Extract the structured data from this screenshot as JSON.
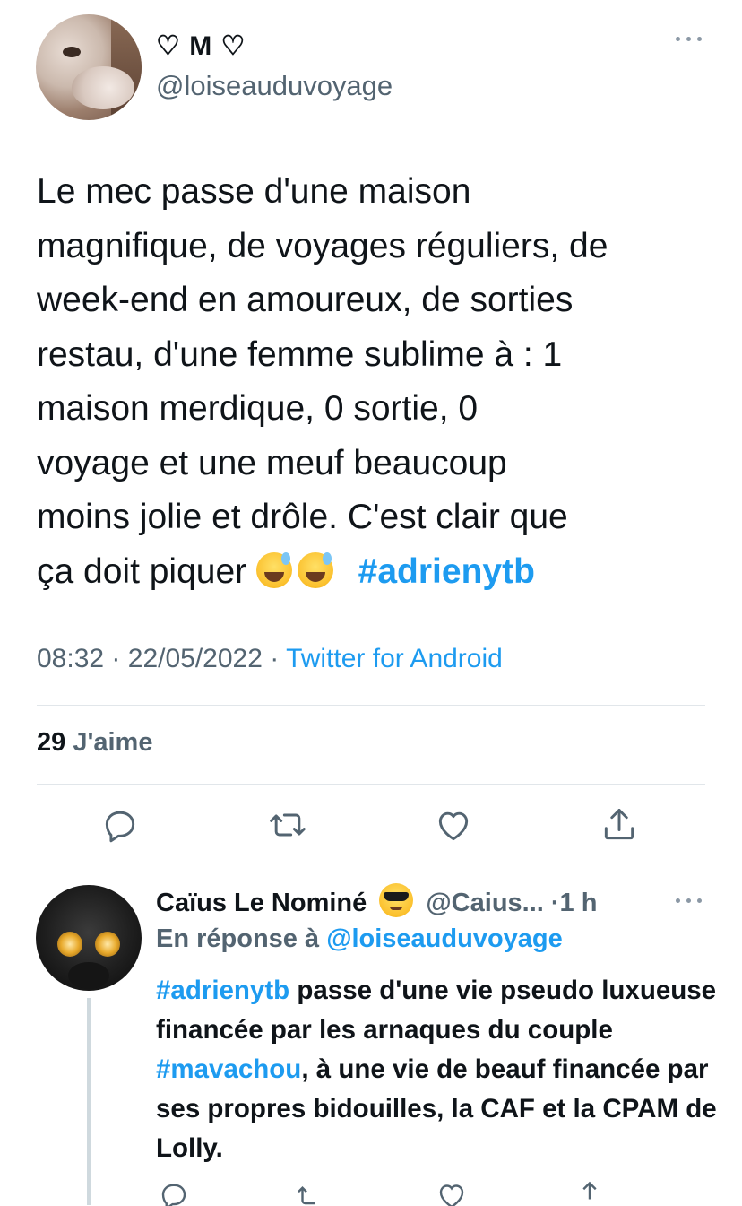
{
  "tweet": {
    "display_name": "♡ M ♡",
    "handle": "@loiseauduvoyage",
    "text_lines": [
      "Le mec passe d'une maison",
      "magnifique, de voyages réguliers, de",
      "week-end en amoureux, de sorties",
      "restau, d'une femme sublime à : 1",
      "maison merdique, 0 sortie, 0",
      "voyage et une meuf beaucoup",
      "moins jolie et drôle. C'est clair que",
      "ça doit piquer"
    ],
    "emojis": [
      "grinning-sweat-emoji",
      "grinning-sweat-emoji"
    ],
    "hashtag": "#adrienytb",
    "time": "08:32",
    "date": "22/05/2022",
    "separator": "·",
    "source": "Twitter for Android",
    "likes_count": "29",
    "likes_label": "J'aime",
    "actions": [
      "reply-icon",
      "retweet-icon",
      "like-icon",
      "share-icon"
    ],
    "more_icon": "more-icon"
  },
  "reply": {
    "display_name": "Caïus Le Nominé",
    "emoji": "sunglasses-emoji",
    "handle": "@Caius...",
    "time": "·1 h",
    "reply_to_prefix": "En réponse à",
    "reply_to_mention": "@loiseauduvoyage",
    "text_parts": {
      "hashtag1": "#adrienytb",
      "seg1": " passe d'une vie pseudo luxueuse financée par les arnaques du couple ",
      "hashtag2": "#mavachou",
      "seg2": ", à une vie de beauf financée par ses propres bidouilles, la CAF et la CPAM de Lolly."
    },
    "more_icon": "more-icon"
  },
  "colors": {
    "accent": "#1d9bf0",
    "secondary_text": "#536471",
    "primary_text": "#0f1419",
    "divider": "#e1e6ea"
  }
}
